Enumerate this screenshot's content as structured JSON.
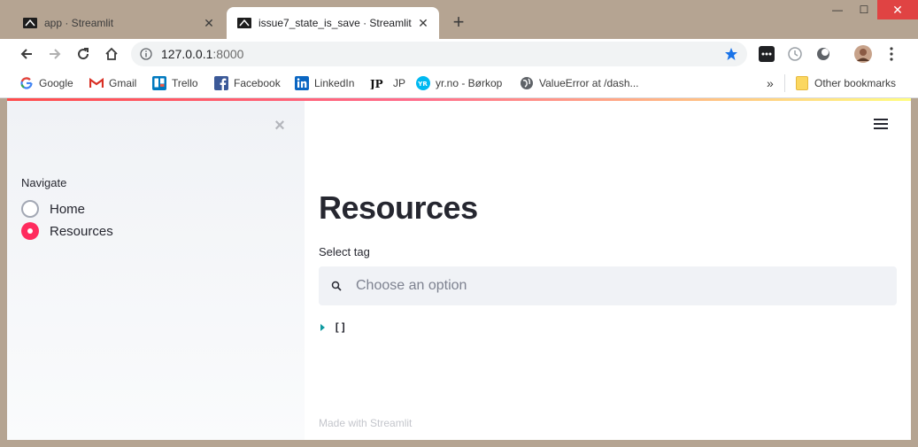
{
  "browser": {
    "tabs": [
      {
        "title": "app · Streamlit",
        "active": false
      },
      {
        "title": "issue7_state_is_save · Streamlit",
        "active": true
      }
    ],
    "new_tab_label": "+",
    "close_glyph": "✕",
    "window_controls": {
      "minimize": "—",
      "maximize": "☐",
      "close": "✕"
    },
    "url_host": "127.0.0.1",
    "url_port": ":8000",
    "bookmarks": [
      {
        "label": "Google",
        "icon": "google-icon"
      },
      {
        "label": "Gmail",
        "icon": "gmail-icon"
      },
      {
        "label": "Trello",
        "icon": "trello-icon"
      },
      {
        "label": "Facebook",
        "icon": "facebook-icon"
      },
      {
        "label": "LinkedIn",
        "icon": "linkedin-icon"
      },
      {
        "label": "JP",
        "icon": "jp-icon"
      },
      {
        "label": "yr.no - Børkop",
        "icon": "yr-icon"
      },
      {
        "label": "ValueError at /dash...",
        "icon": "globe-icon"
      }
    ],
    "overflow_label": "»",
    "other_bookmarks": "Other bookmarks",
    "accent_color": "#1a73e8"
  },
  "sidebar": {
    "close_glyph": "×",
    "radio_label": "Navigate",
    "options": [
      {
        "label": "Home",
        "selected": false
      },
      {
        "label": "Resources",
        "selected": true
      }
    ],
    "accent_color": "#ff2b5e"
  },
  "main": {
    "title": "Resources",
    "select_label": "Select tag",
    "select_placeholder": "Choose an option",
    "json_value": "[]",
    "footer": "Made with Streamlit"
  }
}
